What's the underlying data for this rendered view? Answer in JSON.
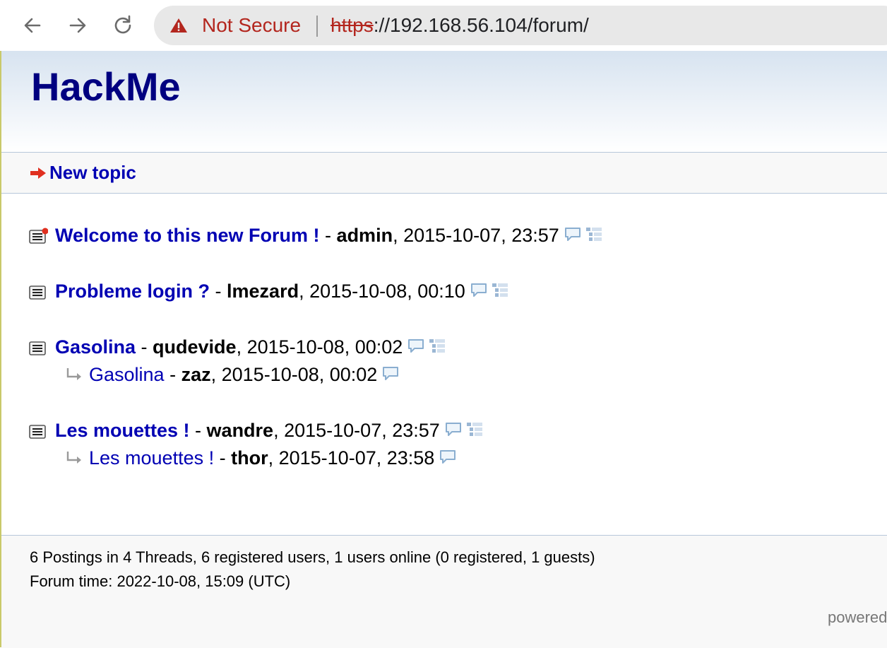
{
  "browser": {
    "security_label": "Not Secure",
    "url_scheme": "https",
    "url_rest": "://192.168.56.104/forum/"
  },
  "site": {
    "title": "HackMe",
    "new_topic": "New topic"
  },
  "threads": [
    {
      "title": "Welcome to this new Forum !",
      "author": "admin",
      "date": "2015-10-07, 23:57",
      "new": true,
      "replies": []
    },
    {
      "title": "Probleme login ?",
      "author": "lmezard",
      "date": "2015-10-08, 00:10",
      "new": false,
      "replies": []
    },
    {
      "title": "Gasolina",
      "author": "qudevide",
      "date": "2015-10-08, 00:02",
      "new": false,
      "replies": [
        {
          "title": "Gasolina",
          "author": "zaz",
          "date": "2015-10-08, 00:02"
        }
      ]
    },
    {
      "title": "Les mouettes !",
      "author": "wandre",
      "date": "2015-10-07, 23:57",
      "new": false,
      "replies": [
        {
          "title": "Les mouettes !",
          "author": "thor",
          "date": "2015-10-07, 23:58"
        }
      ]
    }
  ],
  "footer": {
    "stats": "6 Postings in 4 Threads, 6 registered users, 1 users online (0 registered, 1 guests)",
    "forum_time": "Forum time: 2022-10-08, 15:09 (UTC)",
    "powered": "powered"
  },
  "separator": " - ",
  "comma": ", ",
  "colors": {
    "link": "#0000b3",
    "title": "#000080",
    "warning": "#b3261e",
    "new_dot": "#e03020"
  },
  "icons": {
    "back": "back-arrow-icon",
    "forward": "forward-arrow-icon",
    "reload": "reload-icon",
    "warning": "warning-triangle-icon",
    "new_topic": "red-arrow-icon",
    "thread": "thread-document-icon",
    "reply": "reply-arrow-icon",
    "comment": "comment-bubble-icon",
    "tree": "tree-view-icon"
  }
}
